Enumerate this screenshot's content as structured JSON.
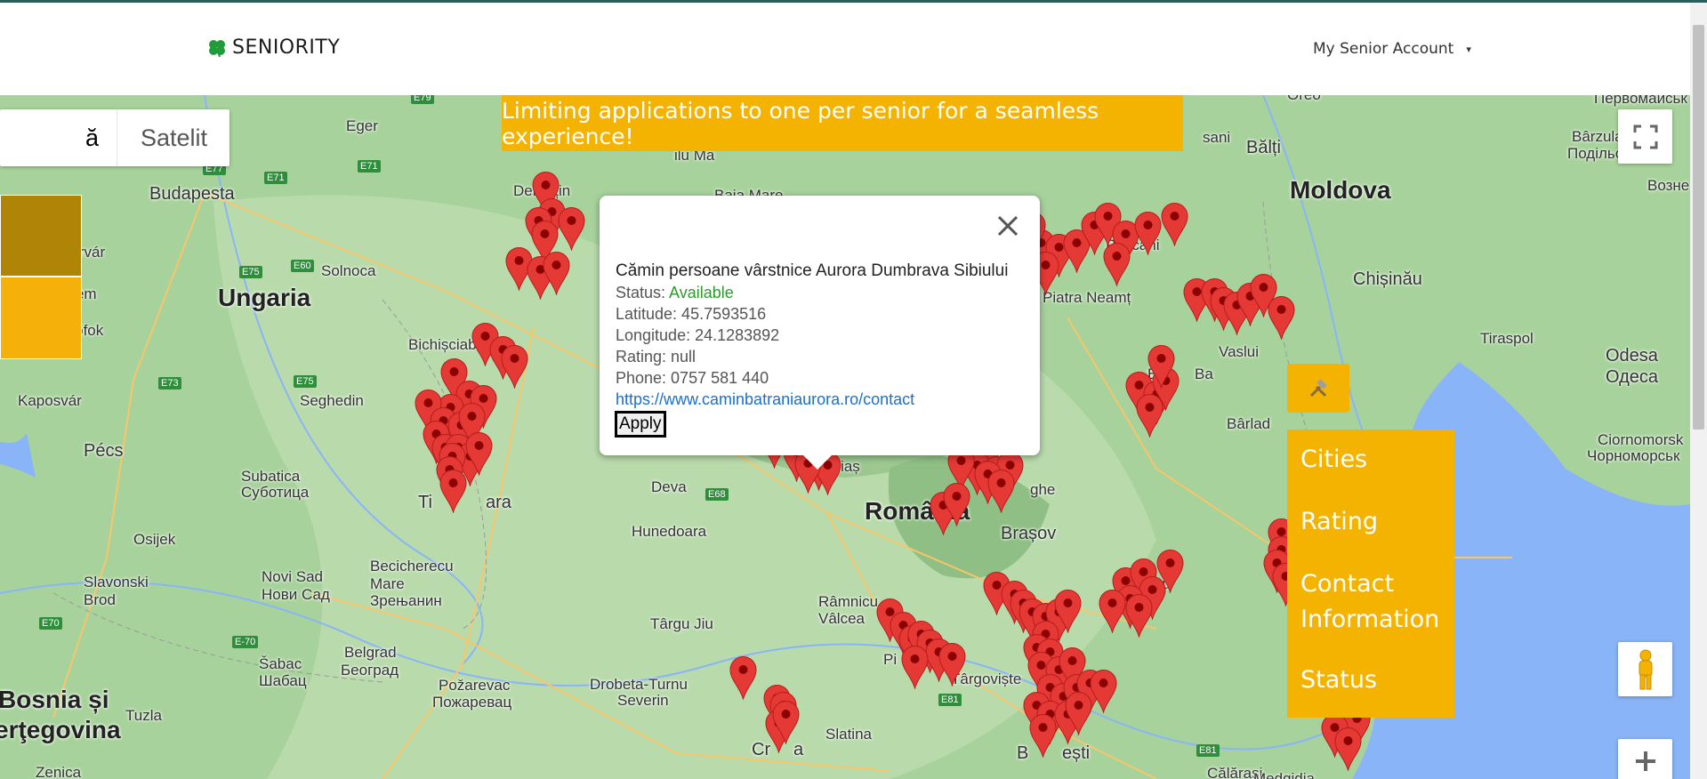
{
  "navbar": {
    "brand": "SENIORITY",
    "account_label": "My Senior Account",
    "caret": "▾"
  },
  "banner": {
    "text": "Limiting applications to one per senior for a seamless experience!"
  },
  "map_type": {
    "harta_visible": "ă",
    "satelit": "Satelit"
  },
  "popup": {
    "title": "Cămin persoane vârstnice Aurora Dumbrava Sibiului",
    "status_label": "Status: ",
    "status_value": "Available",
    "latitude": "Latitude: 45.7593516",
    "longitude": "Longitude: 24.1283892",
    "rating": "Rating: null",
    "phone": "Phone: 0757 581 440",
    "link": "https://www.caminbatraniaurora.ro/contact",
    "apply_label": "Apply"
  },
  "filter_menu": {
    "items": [
      "Cities",
      "Rating",
      "Contact Information",
      "Status"
    ]
  },
  "map_labels": [
    "Moldova",
    "Ungaria",
    "România",
    "Bosnia și",
    "erţegovina",
    "Budapesta",
    "Debrețin",
    "Eger",
    "Székesfehérvár",
    "Solnoca",
    "Veszprém",
    "Siófok",
    "Kaposvár",
    "Pécs",
    "Seghedin",
    "Subatica",
    "Суботица",
    "Osijek",
    "Novi Sad",
    "Нови Сад",
    "Becicherecu",
    "Mare",
    "Зрењанин",
    "Slavonski",
    "Brod",
    "Belgrad",
    "Београд",
    "Šabac",
    "Шабац",
    "Požarevac",
    "Пожаревац",
    "Tuzla",
    "Zenica",
    "Bichișciaba",
    "Ti",
    "ara",
    "Deva",
    "Hunedoara",
    "Târgu Jiu",
    "Drobeta-Turnu",
    "Severin",
    "Slatina",
    "Râmnicu",
    "Vâlcea",
    "Pi",
    "Târgoviște",
    "B",
    "ești",
    "Călărași",
    "Cr",
    "a",
    "Brașov",
    "Piatra Neamț",
    "Pașcani",
    "Bălți",
    "Chișinău",
    "Tiraspol",
    "Odesa",
    "Одеса",
    "Vaslui",
    "Bârlad",
    "Ciornomorsk",
    "Чорноморськ",
    "Bârzula",
    "Подільськ",
    "Bu",
    "Ba",
    "B",
    "au",
    "Br",
    "ea",
    "ghe",
    "ilu Ma",
    "Baia Mare",
    "Mediaș",
    "Medgidia",
    "Первомайськ",
    "Вознe",
    "Oreo",
    "sani",
    "E79",
    "E77",
    "E71",
    "E71",
    "E75",
    "E60",
    "E73",
    "E75",
    "E70",
    "E-70",
    "E68",
    "E81",
    "E81"
  ],
  "colors": {
    "accent": "#f5b301",
    "side_tab_dark": "#b08406",
    "pin": "#e53935",
    "link": "#1a6fd1",
    "status_available": "#2e9a2e"
  },
  "icons": {
    "brand": "clover-icon",
    "close": "close-icon",
    "fullscreen": "fullscreen-icon",
    "pegman": "pegman-icon",
    "zoom_in": "plus-icon",
    "tools": "hammer-icon"
  }
}
